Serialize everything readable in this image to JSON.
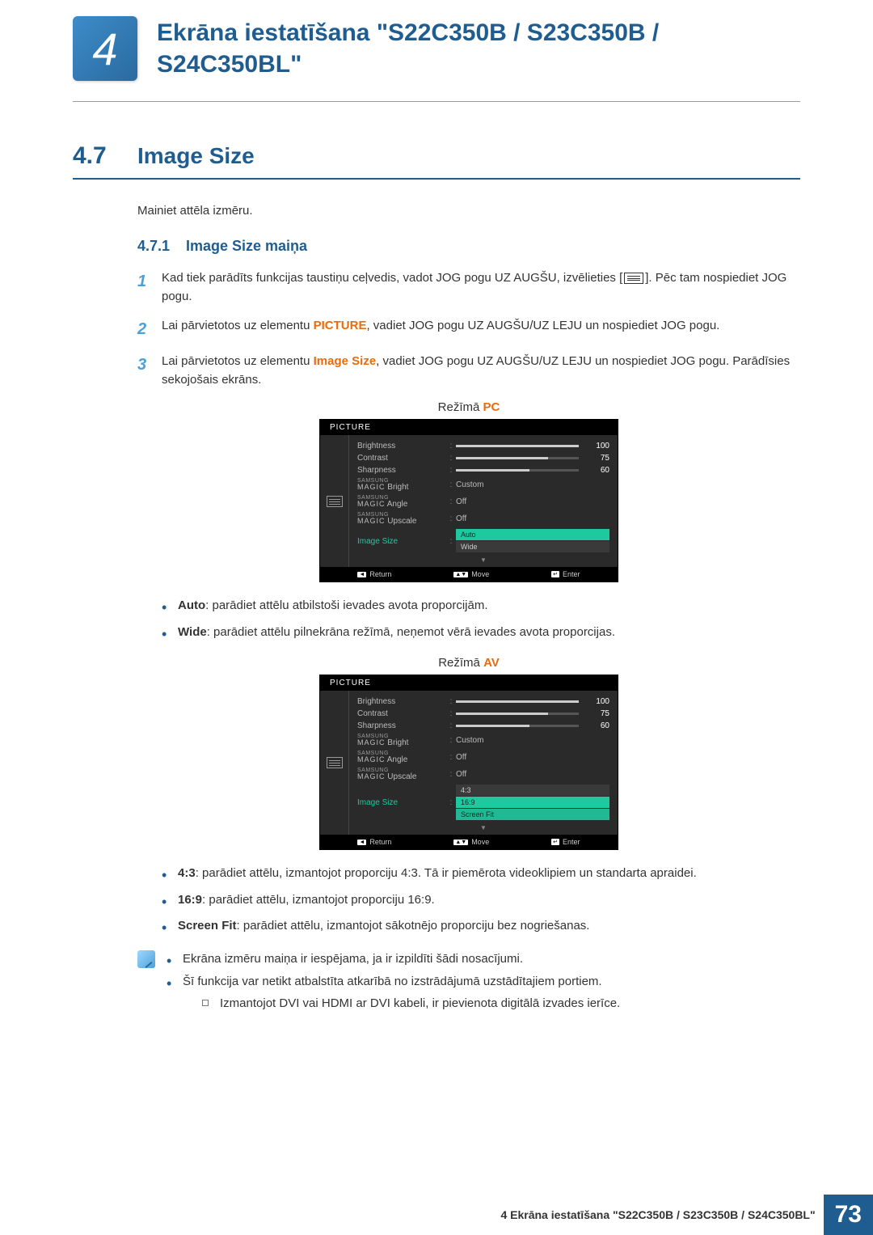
{
  "chapterNumber": "4",
  "headerTitle": "Ekrāna iestatīšana \"S22C350B / S23C350B / S24C350BL\"",
  "section": {
    "number": "4.7",
    "title": "Image Size",
    "intro": "Mainiet attēla izmēru."
  },
  "subsection": {
    "number": "4.7.1",
    "title": "Image Size maiņa"
  },
  "steps": {
    "s1": {
      "num": "1",
      "before": "Kad tiek parādīts funkcijas taustiņu ceļvedis, vadot JOG pogu UZ AUGŠU, izvēlieties [",
      "after": "]. Pēc tam nospiediet JOG pogu."
    },
    "s2": {
      "num": "2",
      "before": "Lai pārvietotos uz elementu ",
      "hl": "PICTURE",
      "after": ", vadiet JOG pogu UZ AUGŠU/UZ LEJU un nospiediet JOG pogu."
    },
    "s3": {
      "num": "3",
      "before": "Lai pārvietotos uz elementu ",
      "hl": "Image Size",
      "after": ", vadiet JOG pogu UZ AUGŠU/UZ LEJU un nospiediet JOG pogu. Parādīsies sekojošais ekrāns."
    }
  },
  "modePrefix": "Režīmā ",
  "modePC": "PC",
  "modeAV": "AV",
  "osd": {
    "title": "PICTURE",
    "rows": {
      "brightness": "Brightness",
      "contrast": "Contrast",
      "sharpness": "Sharpness",
      "magicSup": "SAMSUNG",
      "magicMain": "MAGIC",
      "bright": " Bright",
      "angle": " Angle",
      "upscale": " Upscale",
      "imagesize": "Image Size"
    },
    "vals": {
      "v100": "100",
      "v75": "75",
      "v60": "60",
      "custom": "Custom",
      "off": "Off"
    },
    "pcOptions": {
      "auto": "Auto",
      "wide": "Wide"
    },
    "avOptions": {
      "r43": "4:3",
      "r169": "16:9",
      "fit": "Screen Fit"
    },
    "footer": {
      "return": "Return",
      "move": "Move",
      "enter": "Enter"
    }
  },
  "bulletsPC": {
    "auto": {
      "label": "Auto",
      "text": ": parādiet attēlu atbilstoši ievades avota proporcijām."
    },
    "wide": {
      "label": "Wide",
      "text": ": parādiet attēlu pilnekrāna režīmā, neņemot vērā ievades avota proporcijas."
    }
  },
  "bulletsAV": {
    "r43": {
      "label": "4:3",
      "text": ": parādiet attēlu, izmantojot proporciju 4:3. Tā ir piemērota videoklipiem un standarta apraidei."
    },
    "r169": {
      "label": "16:9",
      "text": ": parādiet attēlu, izmantojot proporciju 16:9."
    },
    "fit": {
      "label": "Screen Fit",
      "text": ": parādiet attēlu, izmantojot sākotnējo proporciju bez nogriešanas."
    }
  },
  "notes": {
    "n1": "Ekrāna izmēru maiņa ir iespējama, ja ir izpildīti šādi nosacījumi.",
    "n2": "Šī funkcija var netikt atbalstīta atkarībā no izstrādājumā uzstādītajiem portiem.",
    "sub": "Izmantojot DVI vai HDMI ar DVI kabeli, ir pievienota digitālā izvades ierīce."
  },
  "footerText": "4 Ekrāna iestatīšana \"S22C350B / S23C350B / S24C350BL\"",
  "pageNumber": "73"
}
